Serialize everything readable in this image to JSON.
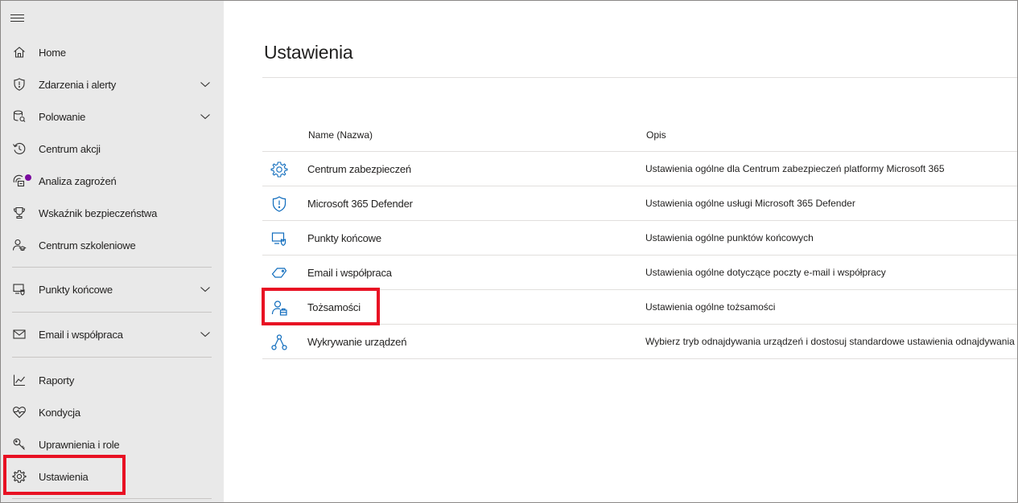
{
  "sidebar": {
    "items": [
      {
        "label": "Home",
        "icon": "home-icon"
      },
      {
        "label": "Zdarzenia i alerty",
        "icon": "shield-icon"
      },
      {
        "label": "Polowanie",
        "icon": "hunting-icon"
      },
      {
        "label": "Centrum akcji",
        "icon": "history-icon"
      },
      {
        "label": "Analiza zagrożeń",
        "icon": "threat-analytics-icon"
      },
      {
        "label": "Wskaźnik bezpieczeństwa",
        "icon": "trophy-icon"
      },
      {
        "label": "Centrum szkoleniowe",
        "icon": "learning-icon"
      },
      {
        "label": "Punkty końcowe",
        "icon": "endpoints-icon"
      },
      {
        "label": "Email i współpraca",
        "icon": "mail-icon"
      },
      {
        "label": "Raporty",
        "icon": "chart-icon"
      },
      {
        "label": "Kondycja",
        "icon": "heart-icon"
      },
      {
        "label": "Uprawnienia i role",
        "icon": "key-icon"
      },
      {
        "label": "Ustawienia",
        "icon": "gear-icon"
      }
    ]
  },
  "main": {
    "title": "Ustawienia",
    "columns": {
      "name": "Name (Nazwa)",
      "desc": "Opis"
    },
    "rows": [
      {
        "name": "Centrum zabezpieczeń",
        "desc": "Ustawienia ogólne dla Centrum zabezpieczeń platformy Microsoft 365",
        "icon": "gear-icon"
      },
      {
        "name": "Microsoft 365 Defender",
        "desc": "Ustawienia ogólne usługi Microsoft 365 Defender",
        "icon": "shield-icon"
      },
      {
        "name": "Punkty końcowe",
        "desc": "Ustawienia ogólne punktów końcowych",
        "icon": "endpoint-shield-icon"
      },
      {
        "name": "Email i współpraca",
        "desc": "Ustawienia ogólne dotyczące poczty e-mail i współpracy",
        "icon": "tag-icon"
      },
      {
        "name": "Tożsamości",
        "desc": "Ustawienia ogólne tożsamości",
        "icon": "identity-icon"
      },
      {
        "name": "Wykrywanie urządzeń",
        "desc": "Wybierz tryb odnajdywania urządzeń i dostosuj standardowe ustawienia odnajdywania",
        "icon": "network-icon"
      }
    ]
  },
  "colors": {
    "accent": "#0f6cbd",
    "highlight": "#e81123",
    "sidebar_bg": "#e9e9e9",
    "notification_dot": "#7a0b9e"
  }
}
